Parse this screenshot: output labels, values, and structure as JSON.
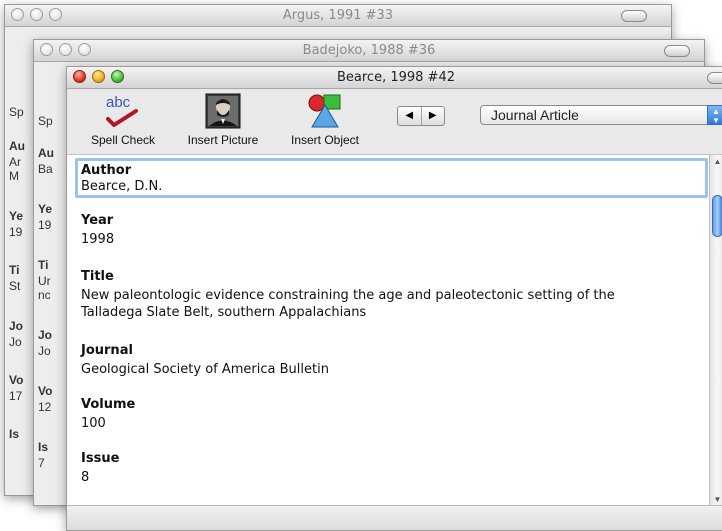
{
  "windows": {
    "back": {
      "title": "Argus, 1991 #33"
    },
    "middle": {
      "title": "Badejoko, 1988 #36"
    },
    "front": {
      "title": "Bearce, 1998 #42"
    }
  },
  "back_peek": {
    "lines": [
      "Sp",
      "Au",
      "Ar",
      "M",
      "Ye",
      "19",
      "Ti",
      "St",
      "Jo",
      "Jo",
      "Vo",
      "17",
      "Is"
    ]
  },
  "middle_peek": {
    "lines": [
      "Sp",
      "Au",
      "Ba",
      "Ye",
      "19",
      "Ti",
      "Ur",
      "nc",
      "Jo",
      "Jo",
      "Vo",
      "12",
      "Is",
      "7"
    ]
  },
  "toolbar": {
    "spell_check": "Spell Check",
    "spell_icon_text": "abc",
    "insert_picture": "Insert Picture",
    "insert_object": "Insert Object",
    "prev_arrow": "◀",
    "next_arrow": "▶",
    "reference_type": "Journal Article"
  },
  "fields": [
    {
      "label": "Author",
      "value": "Bearce, D.N."
    },
    {
      "label": "Year",
      "value": "1998"
    },
    {
      "label": "Title",
      "value": "New paleontologic evidence constraining the age and paleotectonic setting of the Talladega Slate Belt, southern Appalachians"
    },
    {
      "label": "Journal",
      "value": "Geological Society of America Bulletin"
    },
    {
      "label": "Volume",
      "value": "100"
    },
    {
      "label": "Issue",
      "value": "8"
    }
  ]
}
